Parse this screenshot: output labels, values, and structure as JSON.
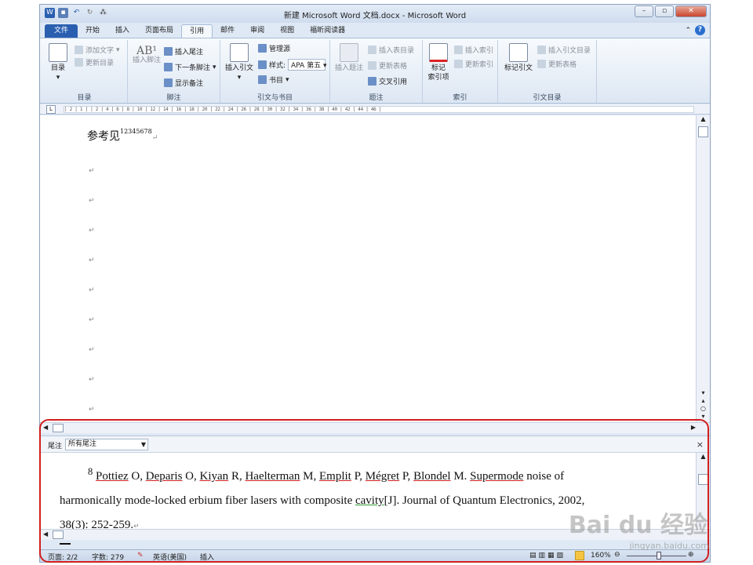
{
  "window": {
    "title": "新建 Microsoft Word 文档.docx - Microsoft Word"
  },
  "tabs": [
    "文件",
    "开始",
    "插入",
    "页面布局",
    "引用",
    "邮件",
    "审阅",
    "视图",
    "福昕阅读器"
  ],
  "active_tab": "引用",
  "ribbon": {
    "toc": {
      "label": "目录",
      "add_text": "添加文字",
      "update_toc": "更新目录",
      "group": "目录"
    },
    "footnotes": {
      "insert_footnote": "插入脚注",
      "insert_endnote": "插入尾注",
      "next_footnote": "下一条脚注",
      "show_notes": "显示备注",
      "group": "脚注",
      "ab_glyph": "AB¹"
    },
    "citations": {
      "insert_citation": "插入引文",
      "manage_sources": "管理源",
      "style_label": "样式:",
      "style_value": "APA 第五",
      "bibliography": "书目",
      "group": "引文与书目"
    },
    "captions": {
      "insert_caption": "插入题注",
      "insert_table_figures": "插入表目录",
      "update_table": "更新表格",
      "cross_reference": "交叉引用",
      "group": "题注"
    },
    "index": {
      "mark_entry": "标记\n索引项",
      "insert_index": "插入索引",
      "update_index": "更新索引",
      "group": "索引"
    },
    "toa": {
      "mark_citation": "标记引文",
      "insert_toa": "插入引文目录",
      "update_table": "更新表格",
      "group": "引文目录"
    }
  },
  "ruler": "| 2 | 1 |   | 2 |   4 | 6 | 8 | 10 | 12 | 14 | 16 | 18 | 20 | 22 | 24 | 26 | 28 | 30 | 32 | 34 | 36 | 38 |  40 | 42 | 44 | 46 |",
  "document": {
    "heading": "参考见",
    "heading_sup": "12345678",
    "paragraph_mark": "↵"
  },
  "notes_pane": {
    "label": "尾注",
    "filter": "所有尾注",
    "note_number": "8",
    "text_parts": [
      {
        "t": "Pottiez",
        "u": "red"
      },
      {
        "t": " O, ",
        "u": ""
      },
      {
        "t": "Deparis",
        "u": "red"
      },
      {
        "t": " O, ",
        "u": ""
      },
      {
        "t": "Kiyan",
        "u": "red"
      },
      {
        "t": " R, ",
        "u": ""
      },
      {
        "t": "Haelterman",
        "u": "red"
      },
      {
        "t": " M, ",
        "u": ""
      },
      {
        "t": "Emplit",
        "u": "red"
      },
      {
        "t": " P, ",
        "u": ""
      },
      {
        "t": "Mégret",
        "u": "red"
      },
      {
        "t": " P, ",
        "u": ""
      },
      {
        "t": "Blondel",
        "u": "red"
      },
      {
        "t": " M. ",
        "u": ""
      },
      {
        "t": "Supermode",
        "u": "red"
      },
      {
        "t": " noise of harmonically mode-locked erbium fiber lasers with composite ",
        "u": ""
      },
      {
        "t": "cavity",
        "u": "green"
      },
      {
        "t": "[J]. Journal of Quantum Electronics, 2002, 38(3): 252-259.",
        "u": ""
      }
    ]
  },
  "status": {
    "page": "页面: 2/2",
    "words": "字数: 279",
    "language": "英语(美国)",
    "mode": "插入",
    "zoom": "160%"
  },
  "watermark": {
    "text": "Bai du 经验",
    "url": "jingyan.baidu.com"
  },
  "colors": {
    "file_tab": "#2a5fb0",
    "annotation": "#d11f1f"
  }
}
